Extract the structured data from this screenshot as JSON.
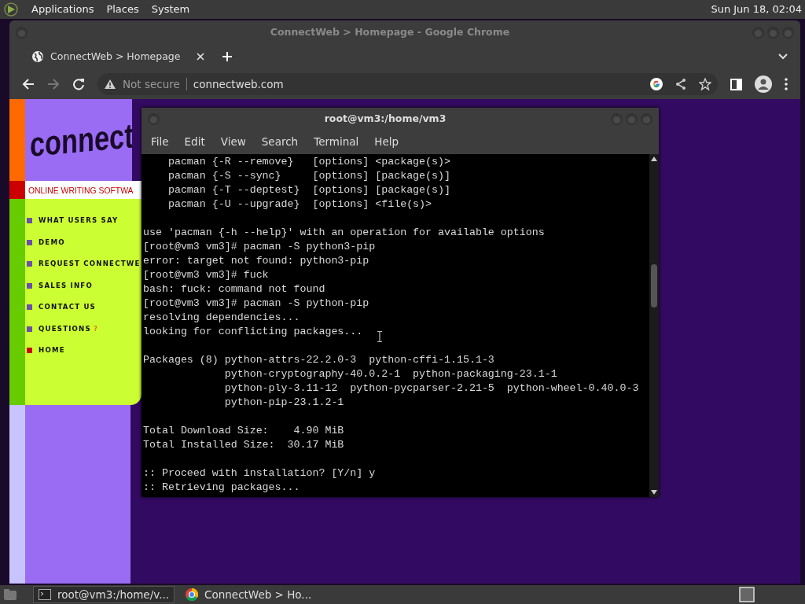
{
  "top_panel": {
    "menus": [
      "Applications",
      "Places",
      "System"
    ],
    "clock": "Sun Jun 18, 02:04"
  },
  "browser": {
    "title": "ConnectWeb > Homepage - Google Chrome",
    "tabs": [
      {
        "label": "ConnectWeb > Homepage",
        "selected": true
      }
    ],
    "toolbar": {
      "back_disabled": false,
      "forward_disabled": true,
      "security": "Not secure",
      "url": "connectweb.com"
    }
  },
  "website": {
    "logo": "connect",
    "tagline": "ONLINE WRITING SOFTWA",
    "menu": [
      {
        "label": "WHAT USERS SAY",
        "color": "#6a4fa8"
      },
      {
        "label": "DEMO",
        "color": "#6a4fa8"
      },
      {
        "label": "REQUEST CONNECTWE",
        "color": "#6a4fa8"
      },
      {
        "label": "SALES INFO",
        "color": "#6a4fa8"
      },
      {
        "label": "CONTACT US",
        "color": "#6a4fa8"
      },
      {
        "label": "QUESTIONS",
        "suffix": "?",
        "color": "#6a4fa8"
      },
      {
        "label": "HOME",
        "color": "#cc0000"
      }
    ]
  },
  "terminal": {
    "title": "root@vm3:/home/vm3",
    "menus": [
      "File",
      "Edit",
      "View",
      "Search",
      "Terminal",
      "Help"
    ],
    "blocks": [
      {
        "lines": [
          "    pacman {-R --remove}   [options] <package(s)>",
          "    pacman {-S --sync}     [options] [package(s)]",
          "    pacman {-T --deptest}  [options] [package(s)]",
          "    pacman {-U --upgrade}  [options] <file(s)>"
        ]
      },
      {
        "lines": [
          "use 'pacman {-h --help}' with an operation for available options",
          "[root@vm3 vm3]# pacman -S python3-pip",
          "error: target not found: python3-pip",
          "[root@vm3 vm3]# fuck",
          "bash: fuck: command not found",
          "[root@vm3 vm3]# pacman -S python-pip",
          "resolving dependencies...",
          "looking for conflicting packages..."
        ]
      },
      {
        "lines": [
          "Packages (8) python-attrs-22.2.0-3  python-cffi-1.15.1-3",
          "             python-cryptography-40.0.2-1  python-packaging-23.1-1",
          "             python-ply-3.11-12  python-pycparser-2.21-5  python-wheel-0.40.0-3",
          "             python-pip-23.1.2-1"
        ]
      },
      {
        "lines": [
          "Total Download Size:    4.90 MiB",
          "Total Installed Size:  30.17 MiB"
        ]
      },
      {
        "lines": [
          ":: Proceed with installation? [Y/n] y",
          ":: Retrieving packages..."
        ]
      }
    ]
  },
  "taskbar": {
    "items": [
      {
        "label": "root@vm3:/home/v...",
        "kind": "terminal"
      },
      {
        "label": "ConnectWeb > Ho...",
        "kind": "browser"
      }
    ]
  }
}
